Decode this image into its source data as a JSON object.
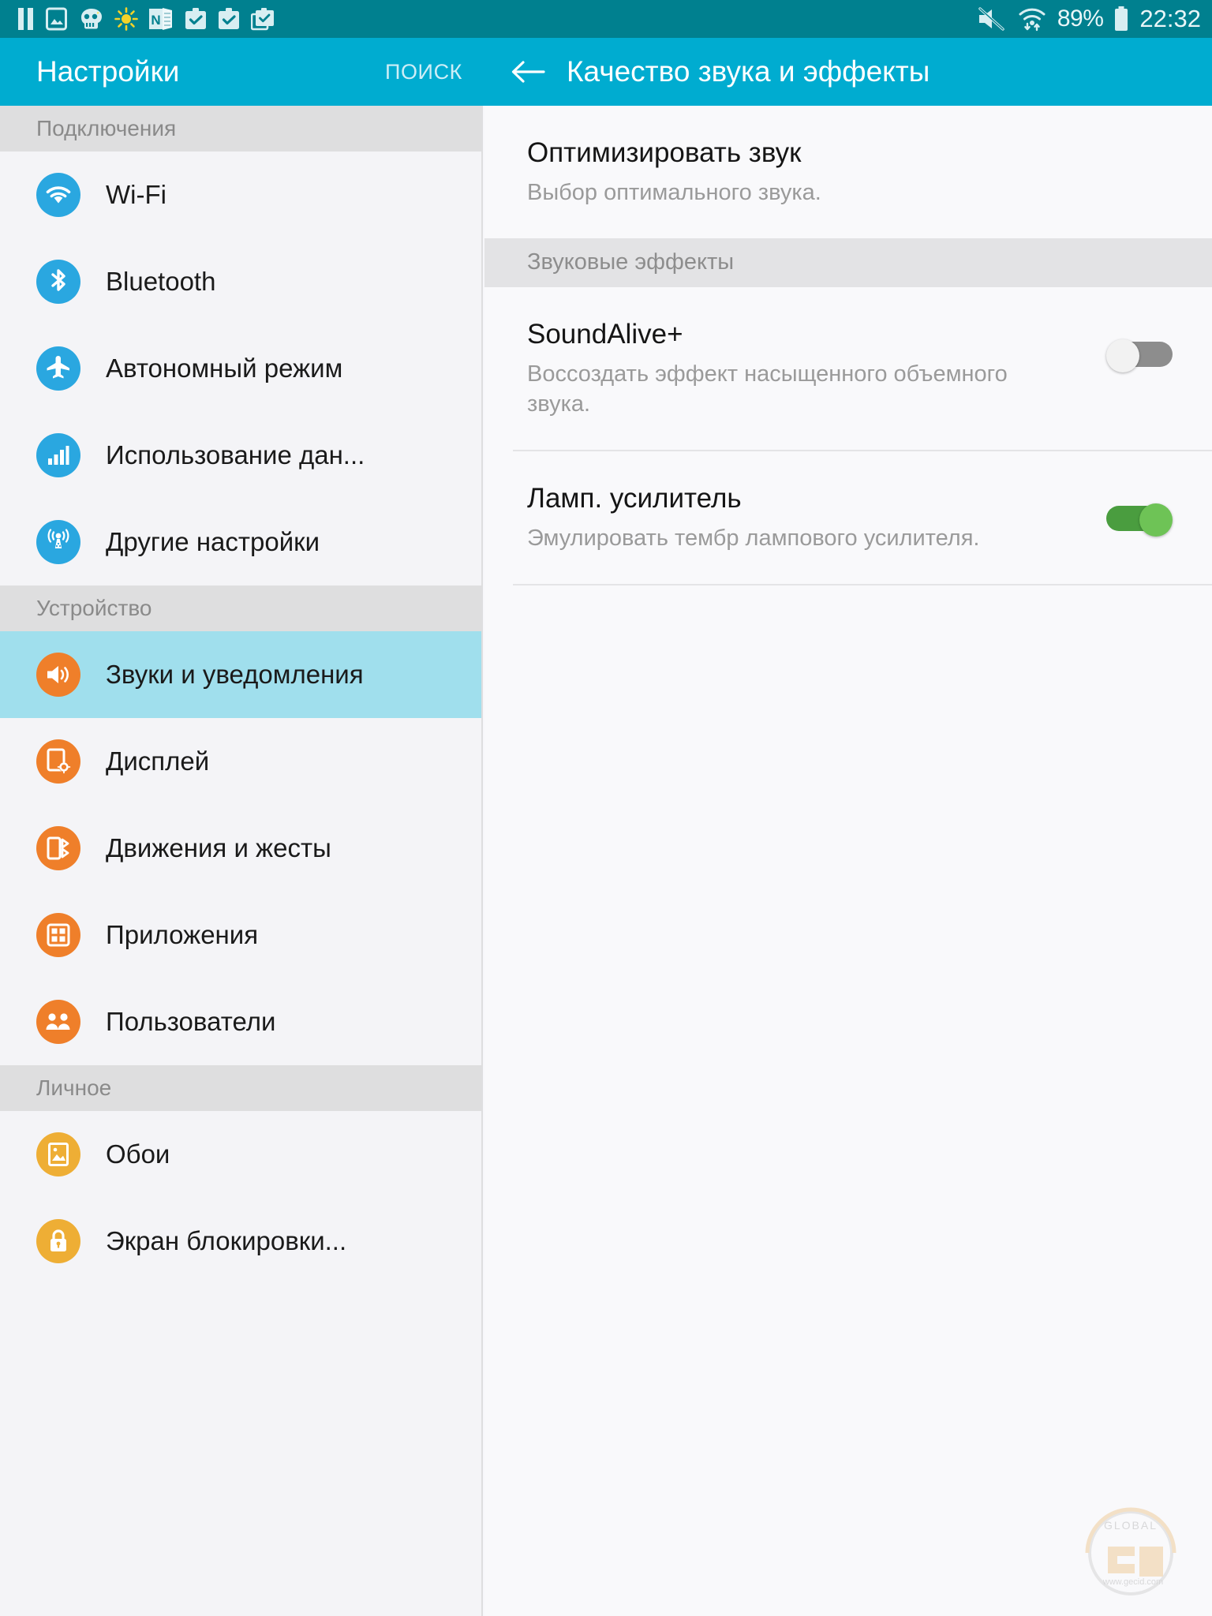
{
  "statusbar": {
    "left_icons": [
      "pause-icon",
      "image-icon",
      "skull-icon",
      "brightness-icon",
      "onenote-icon",
      "briefcase-check-icon",
      "briefcase-check-icon-2",
      "briefcase-check-stack-icon"
    ],
    "mute_icon": "mute-icon",
    "wifi_icon": "wifi-transfer-icon",
    "battery_percent": "89%",
    "battery_icon": "battery-icon",
    "time": "22:32"
  },
  "sidebar": {
    "title": "Настройки",
    "search_label": "ПОИСК",
    "sections": [
      {
        "header": "Подключения",
        "items": [
          {
            "label": "Wi-Fi",
            "icon": "wifi-icon",
            "color": "#2aa7e0",
            "selected": false
          },
          {
            "label": "Bluetooth",
            "icon": "bluetooth-icon",
            "color": "#2aa7e0",
            "selected": false
          },
          {
            "label": "Автономный режим",
            "icon": "airplane-icon",
            "color": "#2aa7e0",
            "selected": false
          },
          {
            "label": "Использование дан...",
            "icon": "data-usage-icon",
            "color": "#2aa7e0",
            "selected": false
          },
          {
            "label": "Другие настройки",
            "icon": "broadcast-icon",
            "color": "#2aa7e0",
            "selected": false
          }
        ]
      },
      {
        "header": "Устройство",
        "items": [
          {
            "label": "Звуки и уведомления",
            "icon": "volume-icon",
            "color": "#ef7f2a",
            "selected": true
          },
          {
            "label": "Дисплей",
            "icon": "display-icon",
            "color": "#ef7f2a",
            "selected": false
          },
          {
            "label": "Движения и жесты",
            "icon": "motion-gestures-icon",
            "color": "#ef7f2a",
            "selected": false
          },
          {
            "label": "Приложения",
            "icon": "apps-grid-icon",
            "color": "#ef7f2a",
            "selected": false
          },
          {
            "label": "Пользователи",
            "icon": "users-icon",
            "color": "#ef7f2a",
            "selected": false
          }
        ]
      },
      {
        "header": "Личное",
        "items": [
          {
            "label": "Обои",
            "icon": "wallpaper-icon",
            "color": "#eeae35",
            "selected": false
          },
          {
            "label": "Экран блокировки...",
            "icon": "lock-icon",
            "color": "#eeae35",
            "selected": false
          }
        ]
      }
    ]
  },
  "detail": {
    "back_icon": "back-arrow-icon",
    "title": "Качество звука и эффекты",
    "optimize": {
      "title": "Оптимизировать звук",
      "subtitle": "Выбор оптимального звука."
    },
    "effects_header": "Звуковые эффекты",
    "effects": [
      {
        "title": "SoundAlive+",
        "subtitle": "Воссоздать эффект насыщенного объемного звука.",
        "toggle_state": "off"
      },
      {
        "title": "Ламп. усилитель",
        "subtitle": "Эмулировать тембр лампового усилителя.",
        "toggle_state": "on"
      }
    ]
  },
  "watermark": {
    "brand": "GLOBAL",
    "url": "www.gecid.com"
  },
  "colors": {
    "statusbar_bg": "#00808f",
    "appbar_bg": "#00acd0",
    "selected_row": "#a0dfed",
    "toggle_on": "#4a9d3f",
    "toggle_off": "#8d8d8d",
    "section_header_bg": "#dededf"
  }
}
